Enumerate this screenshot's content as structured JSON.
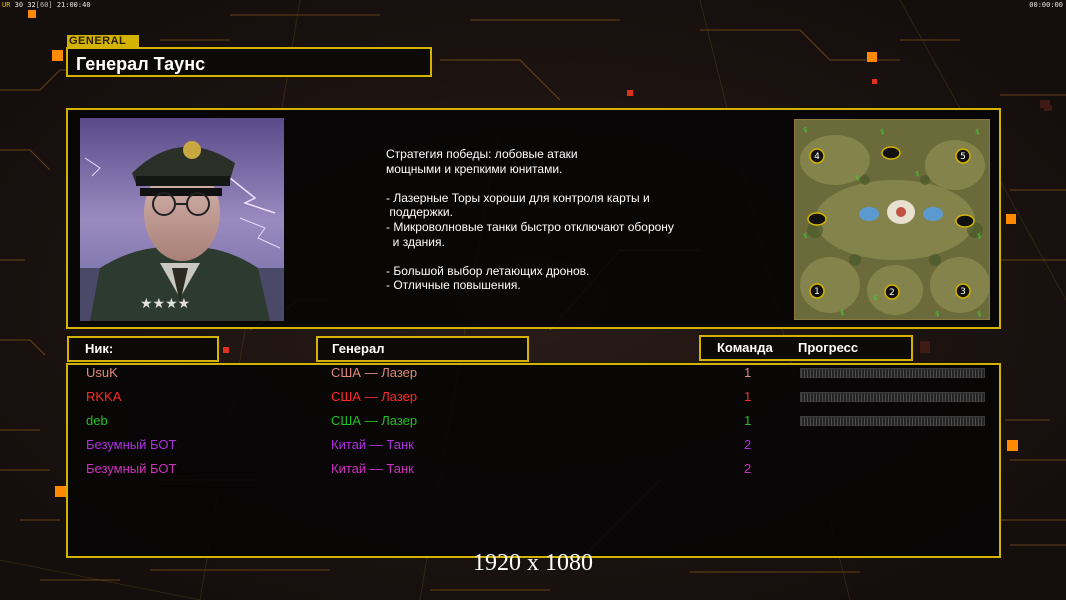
{
  "hud": {
    "fps_label": "UR",
    "frame": "30",
    "fps": "32",
    "cap": "[60]",
    "clock": "21:00:40",
    "timer": "00:00:00"
  },
  "general": {
    "tag": "GENERAL",
    "name": "Генерал Таунс"
  },
  "strategy_lines": [
    "Стратегия победы: лобовые атаки",
    "мощными и крепкими юнитами.",
    "",
    "- Лазерные Торы хороши для контроля карты и",
    " поддержки.",
    "- Микроволновые танки быстро отключают оборону",
    "  и здания.",
    "",
    "- Большой выбор летающих дронов.",
    "- Отличные повышения."
  ],
  "minimap": {
    "slots": [
      "4",
      "5",
      "1",
      "2",
      "3"
    ]
  },
  "headers": {
    "nick": "Ник:",
    "general": "Генерал",
    "team": "Команда",
    "progress": "Прогресс"
  },
  "players": [
    {
      "nick": "UsuK",
      "general": "США — Лазер",
      "team": "1",
      "color": "#e08a7a",
      "progress": true
    },
    {
      "nick": "RKKA",
      "general": "США — Лазер",
      "team": "1",
      "color": "#ff2a2a",
      "progress": true
    },
    {
      "nick": "deb",
      "general": "США — Лазер",
      "team": "1",
      "color": "#22c022",
      "progress": true
    },
    {
      "nick": "Безумный БОТ",
      "general": "Китай — Танк",
      "team": "2",
      "color": "#b030e0",
      "progress": false
    },
    {
      "nick": "Безумный БОТ",
      "general": "Китай — Танк",
      "team": "2",
      "color": "#d030c0",
      "progress": false
    }
  ],
  "resolution": "1920 x 1080",
  "colors": {
    "accent": "#d4b300",
    "background": "#1c1412"
  }
}
